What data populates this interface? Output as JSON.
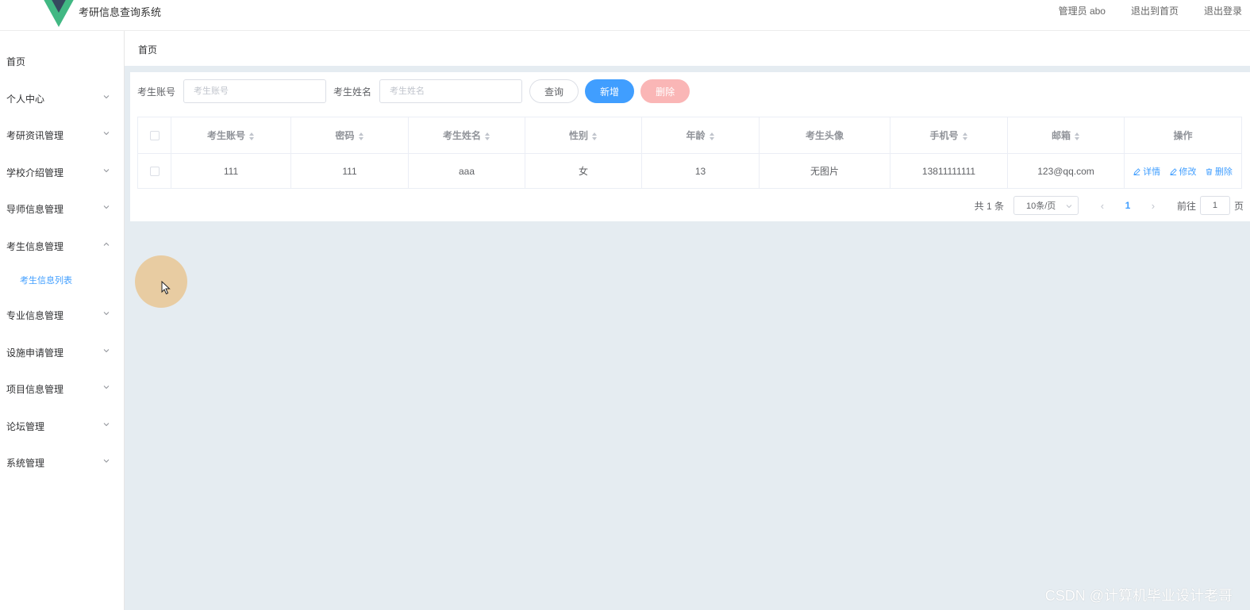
{
  "header": {
    "app_title": "考研信息查询系统",
    "user_label": "管理员 abo",
    "home_link": "退出到首页",
    "logout_link": "退出登录",
    "logo_colors": {
      "outer": "#41b883",
      "inner": "#35495e"
    }
  },
  "sidebar": {
    "items": [
      {
        "label": "首页",
        "icon": "none"
      },
      {
        "label": "个人中心",
        "icon": "chevron-down-icon"
      },
      {
        "label": "考研资讯管理",
        "icon": "chevron-down-icon"
      },
      {
        "label": "学校介绍管理",
        "icon": "chevron-down-icon"
      },
      {
        "label": "导师信息管理",
        "icon": "chevron-down-icon"
      },
      {
        "label": "考生信息管理",
        "icon": "chevron-up-icon"
      },
      {
        "label": "专业信息管理",
        "icon": "chevron-down-icon"
      },
      {
        "label": "设施申请管理",
        "icon": "chevron-down-icon"
      },
      {
        "label": "项目信息管理",
        "icon": "chevron-down-icon"
      },
      {
        "label": "论坛管理",
        "icon": "chevron-down-icon"
      },
      {
        "label": "系统管理",
        "icon": "chevron-down-icon"
      }
    ],
    "active_sub": {
      "label": "考生信息列表"
    }
  },
  "breadcrumb": {
    "label": "首页"
  },
  "search": {
    "account_label": "考生账号",
    "account_placeholder": "考生账号",
    "name_label": "考生姓名",
    "name_placeholder": "考生姓名",
    "query_btn": "查询",
    "add_btn": "新增",
    "delete_btn": "删除"
  },
  "table": {
    "columns": [
      "考生账号",
      "密码",
      "考生姓名",
      "性别",
      "年龄",
      "考生头像",
      "手机号",
      "邮箱",
      "操作"
    ],
    "rows": [
      {
        "account": "111",
        "password": "111",
        "name": "aaa",
        "gender": "女",
        "age": "13",
        "avatar": "无图片",
        "phone": "13811111111",
        "email": "123@qq.com",
        "actions": {
          "detail": "详情",
          "edit": "修改",
          "delete": "删除"
        }
      }
    ]
  },
  "pager": {
    "total": "共 1 条",
    "page_size": "10条/页",
    "current": "1",
    "goto_prefix": "前往",
    "goto_value": "1",
    "goto_suffix": "页"
  },
  "watermark": "CSDN @计算机毕业设计老哥",
  "colors": {
    "primary": "#409eff",
    "danger_disabled": "#fab6b6",
    "content_bg": "#e5ecf1",
    "cursor_halo": "#e9c794"
  }
}
